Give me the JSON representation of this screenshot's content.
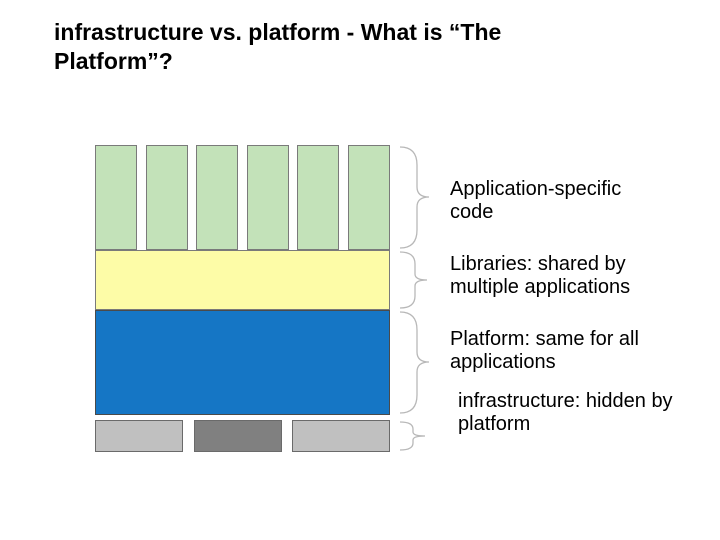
{
  "title": "infrastructure vs. platform - What is “The Platform”?",
  "layers": {
    "apps": {
      "label": "Application-specific code",
      "color": "#c3e2b9",
      "count": 6
    },
    "libs": {
      "label": "Libraries: shared by multiple applications",
      "color": "#fdfca7"
    },
    "plat": {
      "label": "Platform: same for all applications",
      "color": "#1576c5"
    },
    "infra": {
      "label": "infrastructure: hidden by platform",
      "colors": [
        "#c0c0c0",
        "#808080",
        "#c0c0c0"
      ]
    }
  }
}
